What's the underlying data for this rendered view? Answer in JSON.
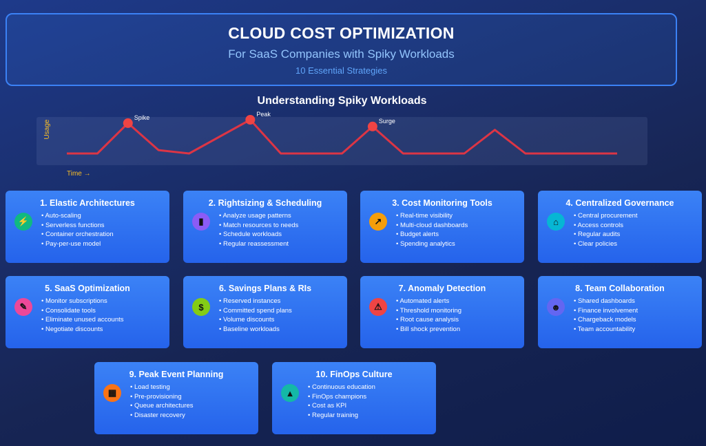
{
  "header": {
    "title": "CLOUD COST OPTIMIZATION",
    "subtitle": "For SaaS Companies with Spiky Workloads",
    "tagline": "10 Essential Strategies"
  },
  "section_title": "Understanding Spiky Workloads",
  "chart_data": {
    "type": "line",
    "title": "Understanding Spiky Workloads",
    "xlabel": "Time →",
    "ylabel": "Usage",
    "line_color": "#dc3545",
    "x": [
      0,
      1,
      2,
      3,
      4,
      5,
      6,
      7,
      8,
      9,
      10,
      11,
      12,
      13,
      14,
      15,
      16,
      17,
      18
    ],
    "values": [
      0,
      0,
      0.9,
      0.1,
      0,
      0.5,
      1.0,
      0,
      0,
      0,
      0.8,
      0,
      0,
      0,
      0.7,
      0,
      0,
      0,
      0
    ],
    "annotations": [
      {
        "index": 2,
        "label": "Spike"
      },
      {
        "index": 6,
        "label": "Peak"
      },
      {
        "index": 10,
        "label": "Surge"
      }
    ],
    "grid": false
  },
  "strategies": [
    {
      "title": "1. Elastic Architectures",
      "icon": "lightning-icon",
      "glyph": "⚡",
      "color": "#10b981",
      "items": [
        "Auto-scaling",
        "Serverless functions",
        "Container orchestration",
        "Pay-per-use model"
      ]
    },
    {
      "title": "2. Rightsizing & Scheduling",
      "icon": "bar-chart-icon",
      "glyph": "▮",
      "color": "#8b5cf6",
      "items": [
        "Analyze usage patterns",
        "Match resources to needs",
        "Schedule workloads",
        "Regular reassessment"
      ]
    },
    {
      "title": "3. Cost Monitoring Tools",
      "icon": "trend-chart-icon",
      "glyph": "↗",
      "color": "#f59e0b",
      "items": [
        "Real-time visibility",
        "Multi-cloud dashboards",
        "Budget alerts",
        "Spending analytics"
      ]
    },
    {
      "title": "4. Centralized Governance",
      "icon": "building-icon",
      "glyph": "⌂",
      "color": "#06b6d4",
      "items": [
        "Central procurement",
        "Access controls",
        "Regular audits",
        "Clear policies"
      ]
    },
    {
      "title": "5. SaaS Optimization",
      "icon": "wrench-icon",
      "glyph": "✎",
      "color": "#ec4899",
      "items": [
        "Monitor subscriptions",
        "Consolidate tools",
        "Eliminate unused accounts",
        "Negotiate discounts"
      ]
    },
    {
      "title": "6. Savings Plans & RIs",
      "icon": "money-bag-icon",
      "glyph": "$",
      "color": "#84cc16",
      "items": [
        "Reserved instances",
        "Committed spend plans",
        "Volume discounts",
        "Baseline workloads"
      ]
    },
    {
      "title": "7. Anomaly Detection",
      "icon": "alarm-icon",
      "glyph": "⚠",
      "color": "#ef4444",
      "items": [
        "Automated alerts",
        "Threshold monitoring",
        "Root cause analysis",
        "Bill shock prevention"
      ]
    },
    {
      "title": "8. Team Collaboration",
      "icon": "team-icon",
      "glyph": "☻",
      "color": "#6366f1",
      "items": [
        "Shared dashboards",
        "Finance involvement",
        "Chargeback models",
        "Team accountability"
      ]
    },
    {
      "title": "9. Peak Event Planning",
      "icon": "calendar-icon",
      "glyph": "▦",
      "color": "#f97316",
      "items": [
        "Load testing",
        "Pre-provisioning",
        "Queue architectures",
        "Disaster recovery"
      ]
    },
    {
      "title": "10. FinOps Culture",
      "icon": "graduation-cap-icon",
      "glyph": "▲",
      "color": "#14b8a6",
      "items": [
        "Continuous education",
        "FinOps champions",
        "Cost as KPI",
        "Regular training"
      ]
    }
  ]
}
